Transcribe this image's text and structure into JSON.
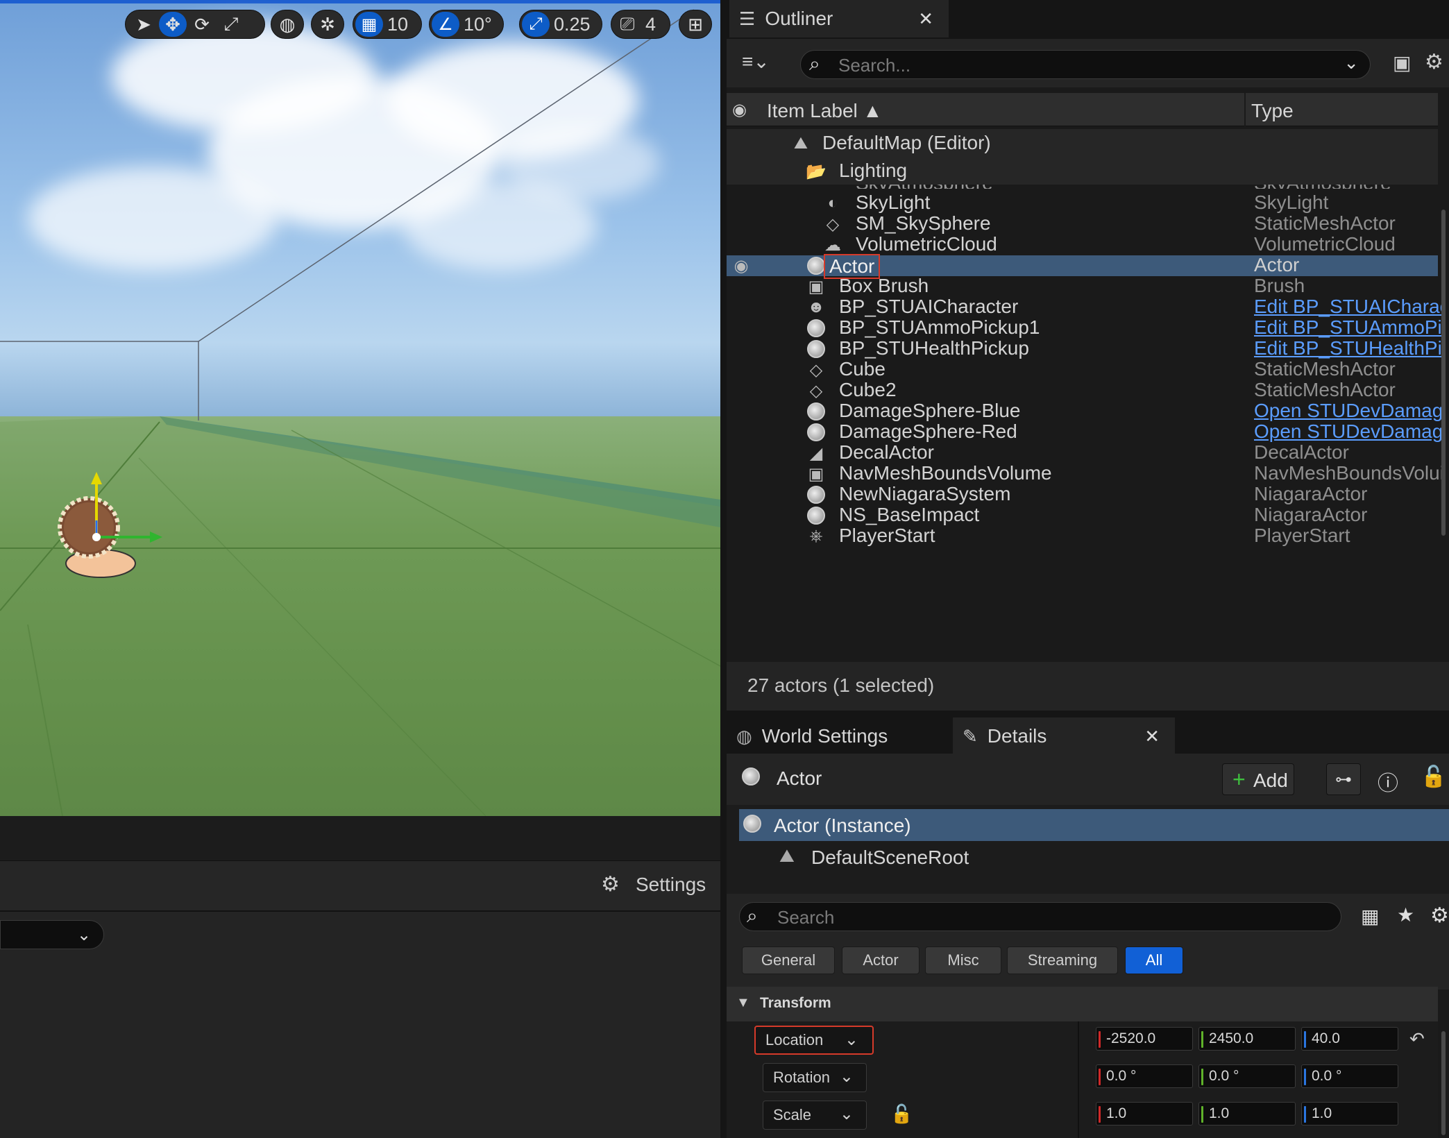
{
  "toolbar": {
    "grid_snap": "10",
    "angle_snap": "10°",
    "scale_snap": "0.25",
    "camera_speed": "4"
  },
  "viewport": {
    "settings_label": "Settings"
  },
  "outliner": {
    "tab_title": "Outliner",
    "search_placeholder": "Search...",
    "col_label": "Item Label ▲",
    "col_type": "Type",
    "map_row": "DefaultMap (Editor)",
    "folder_row": "Lighting",
    "partial_row": {
      "label": "SkyAtmosphere",
      "type": "SkyAtmosphere"
    },
    "items": [
      {
        "label": "SkyLight",
        "type": "SkyLight",
        "link": false
      },
      {
        "label": "SM_SkySphere",
        "type": "StaticMeshActor",
        "link": false
      },
      {
        "label": "VolumetricCloud",
        "type": "VolumetricCloud",
        "link": false
      },
      {
        "label": "Actor",
        "type": "Actor",
        "link": false
      },
      {
        "label": "Box Brush",
        "type": "Brush",
        "link": false
      },
      {
        "label": "BP_STUAICharacter",
        "type": "Edit BP_STUAICharac",
        "link": true
      },
      {
        "label": "BP_STUAmmoPickup1",
        "type": "Edit BP_STUAmmoPic",
        "link": true
      },
      {
        "label": "BP_STUHealthPickup",
        "type": "Edit BP_STUHealthPic",
        "link": true
      },
      {
        "label": "Cube",
        "type": "StaticMeshActor",
        "link": false
      },
      {
        "label": "Cube2",
        "type": "StaticMeshActor",
        "link": false
      },
      {
        "label": "DamageSphere-Blue",
        "type": "Open STUDevDamage",
        "link": true
      },
      {
        "label": "DamageSphere-Red",
        "type": "Open STUDevDamage",
        "link": true
      },
      {
        "label": "DecalActor",
        "type": "DecalActor",
        "link": false
      },
      {
        "label": "NavMeshBoundsVolume",
        "type": "NavMeshBoundsVolui",
        "link": false
      },
      {
        "label": "NewNiagaraSystem",
        "type": "NiagaraActor",
        "link": false
      },
      {
        "label": "NS_BaseImpact",
        "type": "NiagaraActor",
        "link": false
      },
      {
        "label": "PlayerStart",
        "type": "PlayerStart",
        "link": false
      }
    ],
    "status": "27 actors (1 selected)"
  },
  "details": {
    "world_settings_tab": "World Settings",
    "details_tab": "Details",
    "actor_name": "Actor",
    "add_label": "Add",
    "instance": "Actor (Instance)",
    "scene_root": "DefaultSceneRoot",
    "search_placeholder": "Search",
    "filters": [
      "General",
      "Actor",
      "Misc",
      "Streaming",
      "All"
    ],
    "section": "Transform",
    "location": {
      "label": "Location",
      "x": "-2520.0",
      "y": "2450.0",
      "z": "40.0"
    },
    "rotation": {
      "label": "Rotation",
      "x": "0.0 °",
      "y": "0.0 °",
      "z": "0.0 °"
    },
    "scale": {
      "label": "Scale",
      "x": "1.0",
      "y": "1.0",
      "z": "1.0"
    }
  }
}
